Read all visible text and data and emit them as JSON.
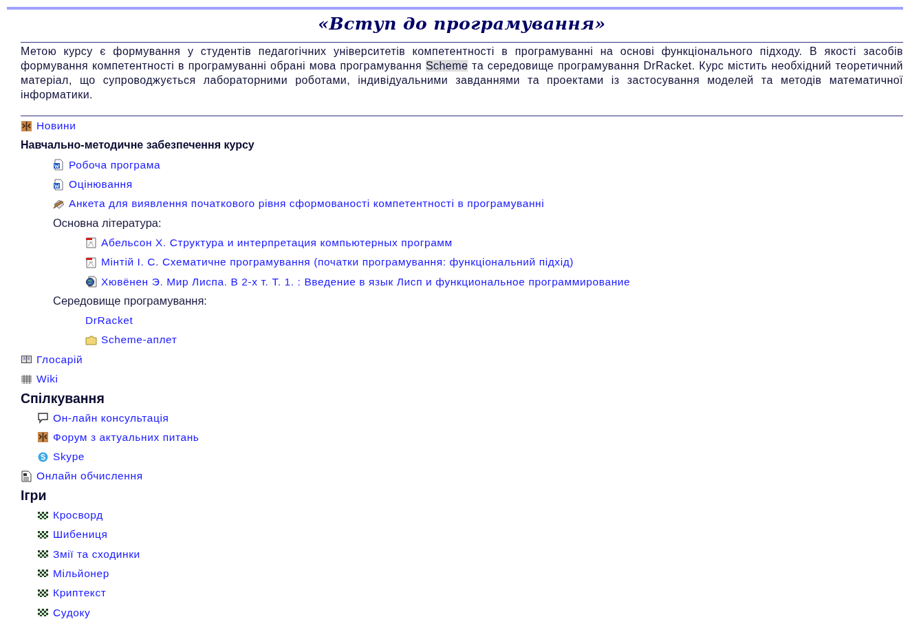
{
  "title": "«Вступ до програмування»",
  "intro": [
    {
      "text": "Метою курсу є формування у студентів педагогічних університетів компетентності в програмуванні на основі функціонального підходу. В якості засобів формування компетентності в програмуванні обрані мова програмування ",
      "highlighted": false
    },
    {
      "text": "Scheme",
      "highlighted": true
    },
    {
      "text": " та середовище програмування DrRacket. Курс містить необхідний теоретичний матеріал, що супроводжується лабораторними роботами, індивідуальними завданнями та проектами із застосування моделей та методів математичної інформатики.",
      "highlighted": false
    }
  ],
  "outline": [
    {
      "kind": "forum",
      "label": "Новини"
    },
    {
      "kind": "subheading",
      "label": "Навчально-методичне забезпечення курсу",
      "children": [
        {
          "kind": "word",
          "label": "Робоча програма"
        },
        {
          "kind": "word",
          "label": "Оцінювання"
        },
        {
          "kind": "questionnaire",
          "label": "Анкета для виявлення початкового рівня сформованості компетентності в програмуванні"
        },
        {
          "kind": "label",
          "label": "Основна література:",
          "children": [
            {
              "kind": "pdf",
              "label": "Абельсон Х. Структура и интерпретация компьютерных программ"
            },
            {
              "kind": "pdf",
              "label": "Мінтій І. С. Схематичне програмування (початки програмування: функціональний підхід)"
            },
            {
              "kind": "web",
              "label": "Хювёнен Э. Мир Лиспа. В 2-х т. Т. 1. : Введение в язык Лисп и функциональное программирование"
            }
          ]
        },
        {
          "kind": "label",
          "label": "Середовище програмування:",
          "children": [
            {
              "kind": "link",
              "label": "DrRacket"
            },
            {
              "kind": "folder",
              "label": "Scheme-аплет"
            }
          ]
        }
      ]
    },
    {
      "kind": "glossary",
      "label": "Глосарій"
    },
    {
      "kind": "wiki",
      "label": "Wiki"
    },
    {
      "kind": "heading",
      "label": "Спілкування",
      "children": [
        {
          "kind": "chat",
          "label": "Он-лайн консультація"
        },
        {
          "kind": "forum",
          "label": "Форум з актуальних питань"
        },
        {
          "kind": "skype",
          "label": "Skype"
        }
      ]
    },
    {
      "kind": "page",
      "label": "Онлайн обчислення"
    },
    {
      "kind": "heading",
      "label": "Ігри",
      "children": [
        {
          "kind": "game",
          "label": "Кросворд"
        },
        {
          "kind": "game",
          "label": "Шибениця"
        },
        {
          "kind": "game",
          "label": "Змії та сходинки"
        },
        {
          "kind": "game",
          "label": "Мільйонер"
        },
        {
          "kind": "game",
          "label": "Криптекст"
        },
        {
          "kind": "game",
          "label": "Судоку"
        }
      ]
    }
  ]
}
